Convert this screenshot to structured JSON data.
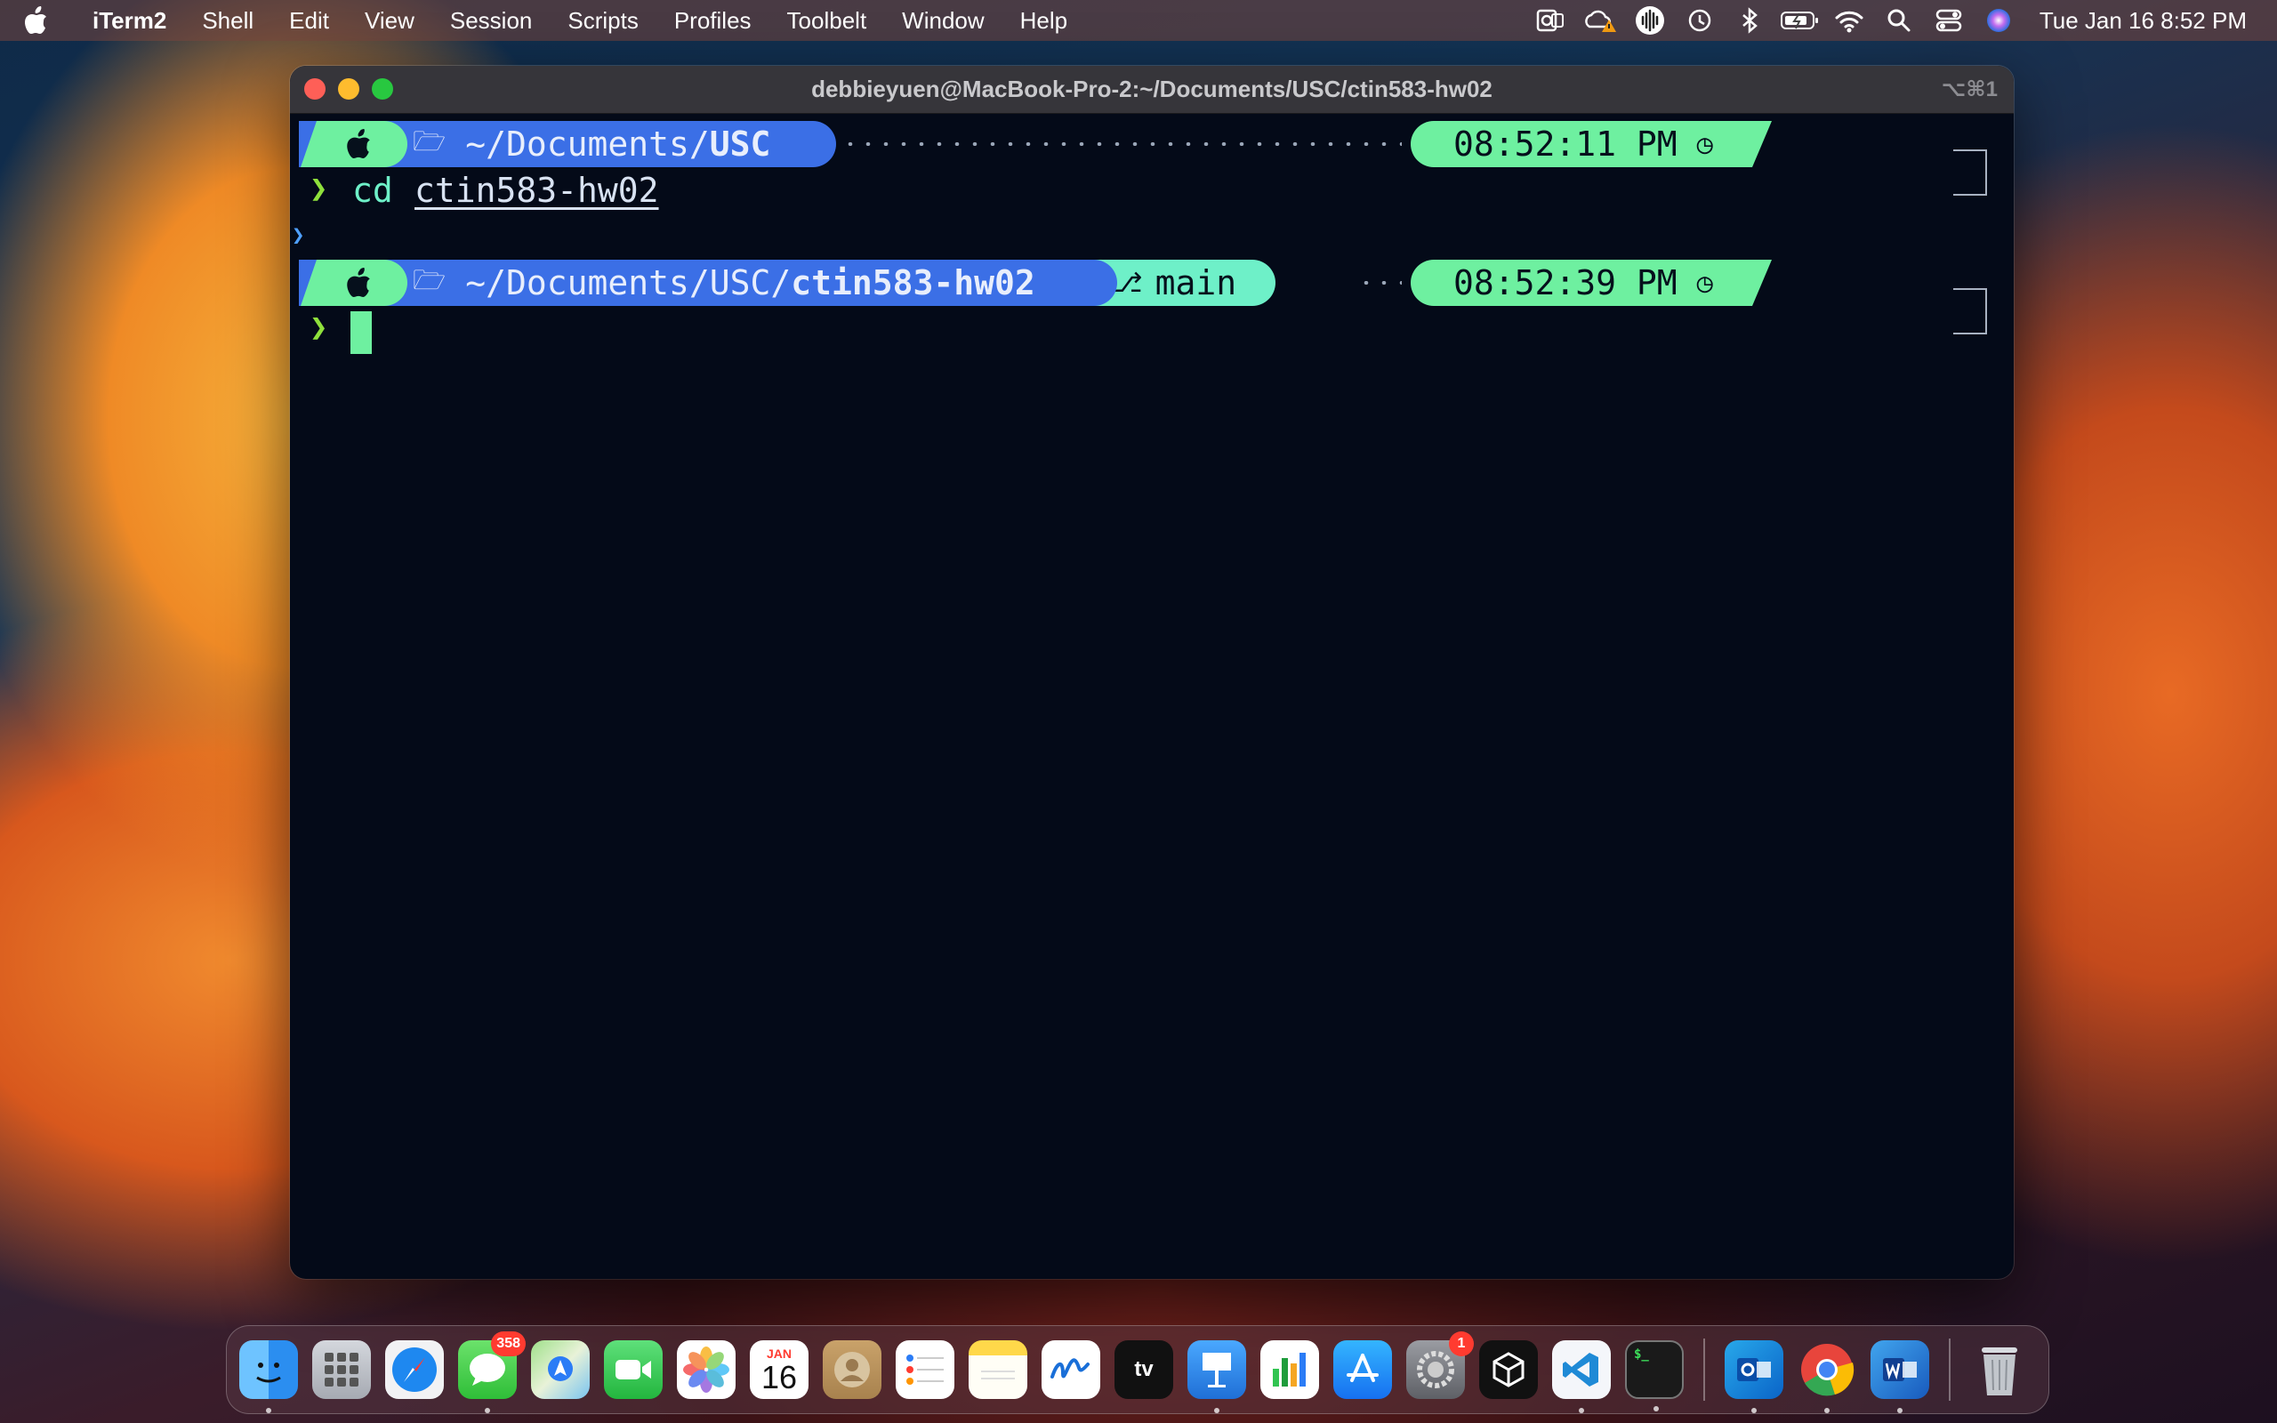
{
  "menubar": {
    "app_name": "iTerm2",
    "menus": [
      "Shell",
      "Edit",
      "View",
      "Session",
      "Scripts",
      "Profiles",
      "Toolbelt",
      "Window",
      "Help"
    ],
    "status_icons": [
      "outlook-icon",
      "creative-cloud-icon",
      "audio-icon",
      "time-machine-icon",
      "bluetooth-icon",
      "battery-icon",
      "wifi-icon",
      "spotlight-icon",
      "control-center-icon",
      "siri-icon"
    ],
    "clock": "Tue Jan 16  8:52 PM"
  },
  "window": {
    "title": "debbieyuen@MacBook-Pro-2:~/Documents/USC/ctin583-hw02",
    "shortcut": "⌥⌘1"
  },
  "terminal": {
    "prompt1": {
      "path_prefix": "~/Documents/",
      "path_bold": "USC",
      "time": "08:52:11 PM"
    },
    "command": {
      "chevron": "❯",
      "cmd": "cd",
      "arg": "ctin583-hw02"
    },
    "prompt2": {
      "path_prefix": "~/Documents/USC/",
      "path_bold": "ctin583-hw02",
      "branch": "main",
      "time": "08:52:39 PM"
    },
    "current_chevron": "❯",
    "accent_green": "#6ef0a0",
    "accent_blue": "#3b6fe6",
    "background": "#040a18"
  },
  "dock": {
    "apps": [
      {
        "name": "finder",
        "badge": "",
        "running": true
      },
      {
        "name": "launchpad",
        "badge": "",
        "running": false
      },
      {
        "name": "safari",
        "badge": "",
        "running": false
      },
      {
        "name": "messages",
        "badge": "358",
        "running": true
      },
      {
        "name": "maps",
        "badge": "",
        "running": false
      },
      {
        "name": "facetime",
        "badge": "",
        "running": false
      },
      {
        "name": "photos",
        "badge": "",
        "running": false
      },
      {
        "name": "calendar",
        "badge": "",
        "running": false,
        "month": "JAN",
        "day": "16"
      },
      {
        "name": "contacts",
        "badge": "",
        "running": false
      },
      {
        "name": "reminders",
        "badge": "",
        "running": false
      },
      {
        "name": "notes",
        "badge": "",
        "running": false
      },
      {
        "name": "freeform",
        "badge": "",
        "running": false
      },
      {
        "name": "apple-tv",
        "badge": "",
        "running": false,
        "label": "tv"
      },
      {
        "name": "keynote",
        "badge": "",
        "running": true
      },
      {
        "name": "numbers",
        "badge": "",
        "running": false
      },
      {
        "name": "app-store",
        "badge": "",
        "running": false
      },
      {
        "name": "system-settings",
        "badge": "1",
        "running": false
      },
      {
        "name": "unity",
        "badge": "",
        "running": false
      },
      {
        "name": "vscode",
        "badge": "",
        "running": true
      },
      {
        "name": "iterm2",
        "badge": "",
        "running": true
      },
      {
        "name": "outlook",
        "badge": "",
        "running": true
      },
      {
        "name": "chrome",
        "badge": "",
        "running": true
      },
      {
        "name": "word",
        "badge": "",
        "running": true
      },
      {
        "name": "trash",
        "badge": "",
        "running": false
      }
    ]
  }
}
